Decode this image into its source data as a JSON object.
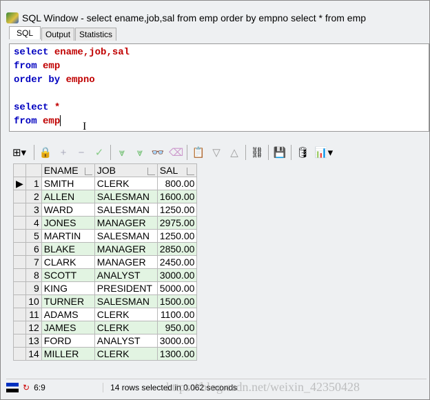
{
  "window": {
    "title": "SQL Window - select ename,job,sal from emp order by empno select * from emp"
  },
  "tabs": [
    {
      "label": "SQL"
    },
    {
      "label": "Output"
    },
    {
      "label": "Statistics"
    }
  ],
  "editor": {
    "lines": [
      [
        "select",
        "ename,job,sal"
      ],
      [
        "from",
        "emp"
      ],
      [
        "order by",
        "empno"
      ],
      [
        "",
        ""
      ],
      [
        "select",
        "*"
      ],
      [
        "from",
        "emp"
      ]
    ]
  },
  "toolbar": {
    "icons": [
      "grid-options-icon",
      "lock-icon",
      "add-record-icon",
      "delete-record-icon",
      "post-changes-icon",
      "fetch-next-icon",
      "fetch-all-icon",
      "find-icon",
      "clear-icon",
      "query-by-example-icon",
      "previous-record-icon",
      "next-record-icon",
      "link-icon",
      "save-icon",
      "export-icon",
      "chart-icon"
    ]
  },
  "grid": {
    "columns": [
      "ENAME",
      "JOB",
      "SAL"
    ],
    "rows": [
      [
        "1",
        "SMITH",
        "CLERK",
        "800.00"
      ],
      [
        "2",
        "ALLEN",
        "SALESMAN",
        "1600.00"
      ],
      [
        "3",
        "WARD",
        "SALESMAN",
        "1250.00"
      ],
      [
        "4",
        "JONES",
        "MANAGER",
        "2975.00"
      ],
      [
        "5",
        "MARTIN",
        "SALESMAN",
        "1250.00"
      ],
      [
        "6",
        "BLAKE",
        "MANAGER",
        "2850.00"
      ],
      [
        "7",
        "CLARK",
        "MANAGER",
        "2450.00"
      ],
      [
        "8",
        "SCOTT",
        "ANALYST",
        "3000.00"
      ],
      [
        "9",
        "KING",
        "PRESIDENT",
        "5000.00"
      ],
      [
        "10",
        "TURNER",
        "SALESMAN",
        "1500.00"
      ],
      [
        "11",
        "ADAMS",
        "CLERK",
        "1100.00"
      ],
      [
        "12",
        "JAMES",
        "CLERK",
        "950.00"
      ],
      [
        "13",
        "FORD",
        "ANALYST",
        "3000.00"
      ],
      [
        "14",
        "MILLER",
        "CLERK",
        "1300.00"
      ]
    ]
  },
  "status": {
    "position": "6:9",
    "message": "14 rows selected in 0.062 seconds"
  },
  "watermark": "https://blog.csdn.net/weixin_42350428"
}
